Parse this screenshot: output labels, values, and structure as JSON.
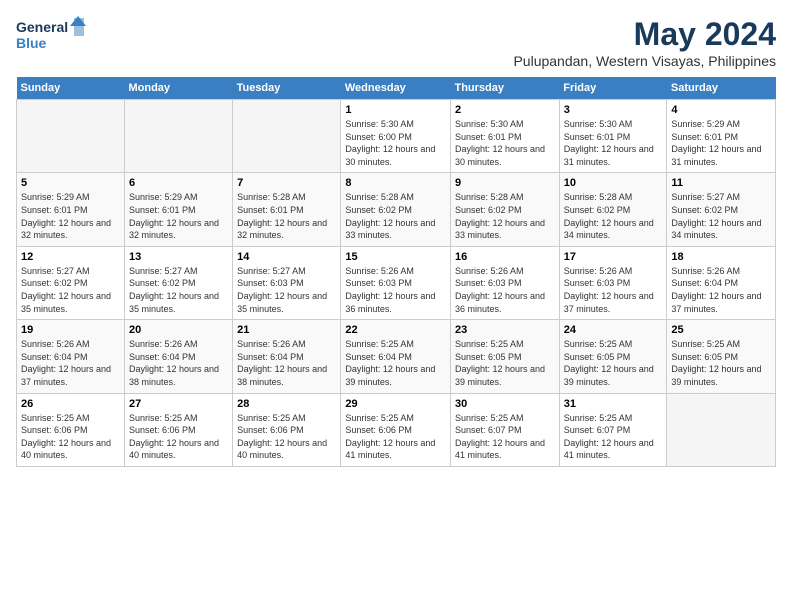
{
  "logo": {
    "line1": "General",
    "line2": "Blue"
  },
  "title": "May 2024",
  "subtitle": "Pulupandan, Western Visayas, Philippines",
  "days_of_week": [
    "Sunday",
    "Monday",
    "Tuesday",
    "Wednesday",
    "Thursday",
    "Friday",
    "Saturday"
  ],
  "weeks": [
    [
      {
        "day": "",
        "sunrise": "",
        "sunset": "",
        "daylight": "",
        "empty": true
      },
      {
        "day": "",
        "sunrise": "",
        "sunset": "",
        "daylight": "",
        "empty": true
      },
      {
        "day": "",
        "sunrise": "",
        "sunset": "",
        "daylight": "",
        "empty": true
      },
      {
        "day": "1",
        "sunrise": "Sunrise: 5:30 AM",
        "sunset": "Sunset: 6:00 PM",
        "daylight": "Daylight: 12 hours and 30 minutes."
      },
      {
        "day": "2",
        "sunrise": "Sunrise: 5:30 AM",
        "sunset": "Sunset: 6:01 PM",
        "daylight": "Daylight: 12 hours and 30 minutes."
      },
      {
        "day": "3",
        "sunrise": "Sunrise: 5:30 AM",
        "sunset": "Sunset: 6:01 PM",
        "daylight": "Daylight: 12 hours and 31 minutes."
      },
      {
        "day": "4",
        "sunrise": "Sunrise: 5:29 AM",
        "sunset": "Sunset: 6:01 PM",
        "daylight": "Daylight: 12 hours and 31 minutes."
      }
    ],
    [
      {
        "day": "5",
        "sunrise": "Sunrise: 5:29 AM",
        "sunset": "Sunset: 6:01 PM",
        "daylight": "Daylight: 12 hours and 32 minutes."
      },
      {
        "day": "6",
        "sunrise": "Sunrise: 5:29 AM",
        "sunset": "Sunset: 6:01 PM",
        "daylight": "Daylight: 12 hours and 32 minutes."
      },
      {
        "day": "7",
        "sunrise": "Sunrise: 5:28 AM",
        "sunset": "Sunset: 6:01 PM",
        "daylight": "Daylight: 12 hours and 32 minutes."
      },
      {
        "day": "8",
        "sunrise": "Sunrise: 5:28 AM",
        "sunset": "Sunset: 6:02 PM",
        "daylight": "Daylight: 12 hours and 33 minutes."
      },
      {
        "day": "9",
        "sunrise": "Sunrise: 5:28 AM",
        "sunset": "Sunset: 6:02 PM",
        "daylight": "Daylight: 12 hours and 33 minutes."
      },
      {
        "day": "10",
        "sunrise": "Sunrise: 5:28 AM",
        "sunset": "Sunset: 6:02 PM",
        "daylight": "Daylight: 12 hours and 34 minutes."
      },
      {
        "day": "11",
        "sunrise": "Sunrise: 5:27 AM",
        "sunset": "Sunset: 6:02 PM",
        "daylight": "Daylight: 12 hours and 34 minutes."
      }
    ],
    [
      {
        "day": "12",
        "sunrise": "Sunrise: 5:27 AM",
        "sunset": "Sunset: 6:02 PM",
        "daylight": "Daylight: 12 hours and 35 minutes."
      },
      {
        "day": "13",
        "sunrise": "Sunrise: 5:27 AM",
        "sunset": "Sunset: 6:02 PM",
        "daylight": "Daylight: 12 hours and 35 minutes."
      },
      {
        "day": "14",
        "sunrise": "Sunrise: 5:27 AM",
        "sunset": "Sunset: 6:03 PM",
        "daylight": "Daylight: 12 hours and 35 minutes."
      },
      {
        "day": "15",
        "sunrise": "Sunrise: 5:26 AM",
        "sunset": "Sunset: 6:03 PM",
        "daylight": "Daylight: 12 hours and 36 minutes."
      },
      {
        "day": "16",
        "sunrise": "Sunrise: 5:26 AM",
        "sunset": "Sunset: 6:03 PM",
        "daylight": "Daylight: 12 hours and 36 minutes."
      },
      {
        "day": "17",
        "sunrise": "Sunrise: 5:26 AM",
        "sunset": "Sunset: 6:03 PM",
        "daylight": "Daylight: 12 hours and 37 minutes."
      },
      {
        "day": "18",
        "sunrise": "Sunrise: 5:26 AM",
        "sunset": "Sunset: 6:04 PM",
        "daylight": "Daylight: 12 hours and 37 minutes."
      }
    ],
    [
      {
        "day": "19",
        "sunrise": "Sunrise: 5:26 AM",
        "sunset": "Sunset: 6:04 PM",
        "daylight": "Daylight: 12 hours and 37 minutes."
      },
      {
        "day": "20",
        "sunrise": "Sunrise: 5:26 AM",
        "sunset": "Sunset: 6:04 PM",
        "daylight": "Daylight: 12 hours and 38 minutes."
      },
      {
        "day": "21",
        "sunrise": "Sunrise: 5:26 AM",
        "sunset": "Sunset: 6:04 PM",
        "daylight": "Daylight: 12 hours and 38 minutes."
      },
      {
        "day": "22",
        "sunrise": "Sunrise: 5:25 AM",
        "sunset": "Sunset: 6:04 PM",
        "daylight": "Daylight: 12 hours and 39 minutes."
      },
      {
        "day": "23",
        "sunrise": "Sunrise: 5:25 AM",
        "sunset": "Sunset: 6:05 PM",
        "daylight": "Daylight: 12 hours and 39 minutes."
      },
      {
        "day": "24",
        "sunrise": "Sunrise: 5:25 AM",
        "sunset": "Sunset: 6:05 PM",
        "daylight": "Daylight: 12 hours and 39 minutes."
      },
      {
        "day": "25",
        "sunrise": "Sunrise: 5:25 AM",
        "sunset": "Sunset: 6:05 PM",
        "daylight": "Daylight: 12 hours and 39 minutes."
      }
    ],
    [
      {
        "day": "26",
        "sunrise": "Sunrise: 5:25 AM",
        "sunset": "Sunset: 6:06 PM",
        "daylight": "Daylight: 12 hours and 40 minutes."
      },
      {
        "day": "27",
        "sunrise": "Sunrise: 5:25 AM",
        "sunset": "Sunset: 6:06 PM",
        "daylight": "Daylight: 12 hours and 40 minutes."
      },
      {
        "day": "28",
        "sunrise": "Sunrise: 5:25 AM",
        "sunset": "Sunset: 6:06 PM",
        "daylight": "Daylight: 12 hours and 40 minutes."
      },
      {
        "day": "29",
        "sunrise": "Sunrise: 5:25 AM",
        "sunset": "Sunset: 6:06 PM",
        "daylight": "Daylight: 12 hours and 41 minutes."
      },
      {
        "day": "30",
        "sunrise": "Sunrise: 5:25 AM",
        "sunset": "Sunset: 6:07 PM",
        "daylight": "Daylight: 12 hours and 41 minutes."
      },
      {
        "day": "31",
        "sunrise": "Sunrise: 5:25 AM",
        "sunset": "Sunset: 6:07 PM",
        "daylight": "Daylight: 12 hours and 41 minutes."
      },
      {
        "day": "",
        "sunrise": "",
        "sunset": "",
        "daylight": "",
        "empty": true
      }
    ]
  ]
}
